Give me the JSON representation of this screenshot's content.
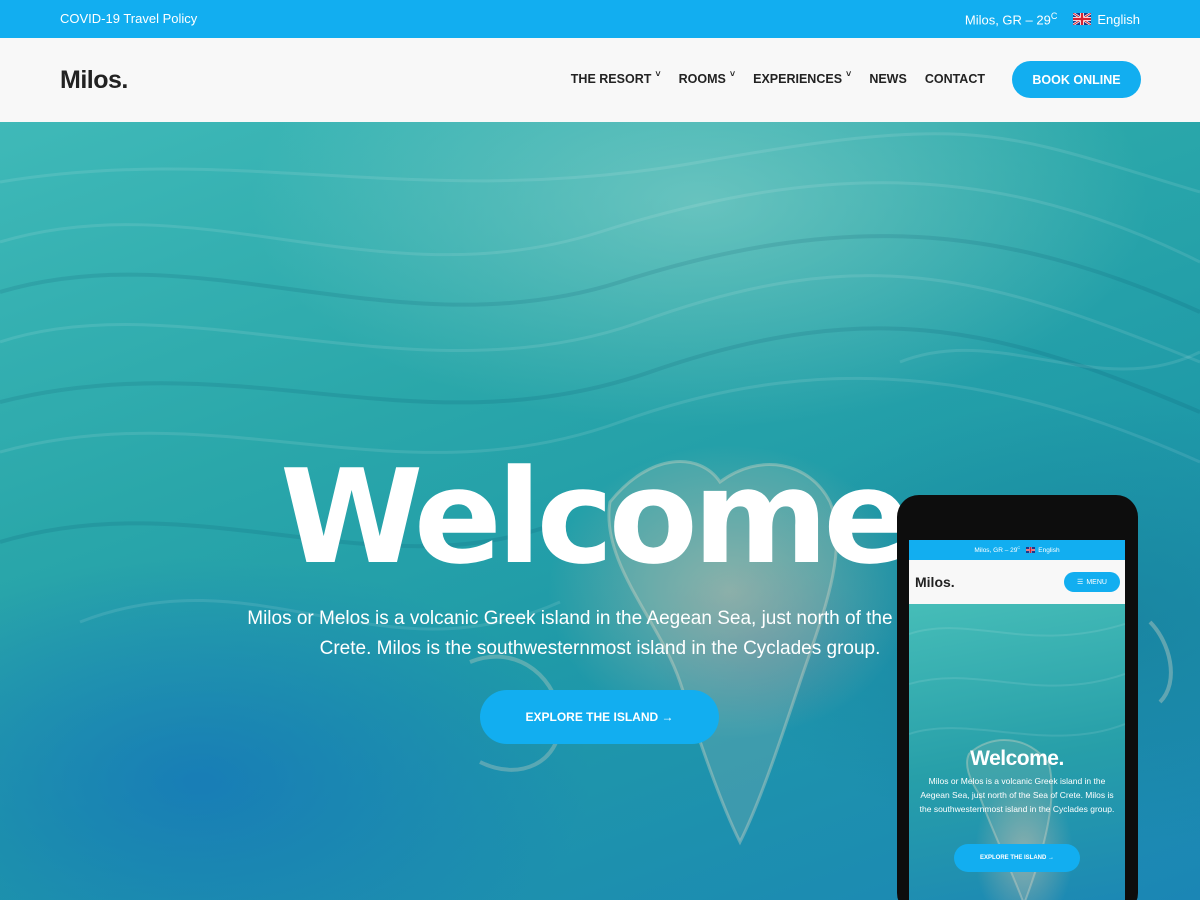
{
  "topbar": {
    "covid_link": "COVID-19 Travel Policy",
    "weather": "Milos, GR – 29",
    "weather_unit": "C",
    "language": "English"
  },
  "header": {
    "logo": "Milos.",
    "nav": [
      {
        "label": "THE RESORT"
      },
      {
        "label": "ROOMS"
      },
      {
        "label": "EXPERIENCES"
      },
      {
        "label": "NEWS"
      },
      {
        "label": "CONTACT"
      }
    ],
    "book_label": "BOOK ONLINE"
  },
  "hero": {
    "title": "Welcome",
    "description": "Milos or Melos is a volcanic Greek island in the Aegean Sea, just north of the Sea of Crete. Milos is the southwesternmost island in the Cyclades group.",
    "button_label": "EXPLORE THE ISLAND →"
  },
  "phone": {
    "weather": "Milos, GR – 29",
    "weather_unit": "C",
    "language": "English",
    "logo": "Milos.",
    "menu_label": "MENU",
    "title": "Welcome.",
    "description": "Milos or Melos is a volcanic Greek island in the Aegean Sea, just north of the Sea of Crete. Milos is the southwesternmost island in the Cyclades group.",
    "button_label": "EXPLORE THE ISLAND →"
  },
  "colors": {
    "accent": "#12aef0",
    "header_bg": "#f8f8f8",
    "text_dark": "#222222"
  }
}
